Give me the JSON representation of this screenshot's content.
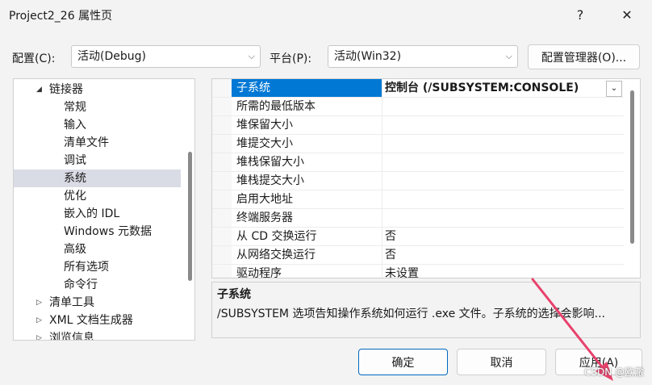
{
  "window": {
    "title": "Project2_26 属性页",
    "help_glyph": "?",
    "close_glyph": "✕"
  },
  "config": {
    "config_label": "配置(C):",
    "config_value": "活动(Debug)",
    "platform_label": "平台(P):",
    "platform_value": "活动(Win32)",
    "manager_button": "配置管理器(O)..."
  },
  "tree": {
    "items": [
      {
        "label": "链接器",
        "expander": "◢"
      },
      {
        "label": "常规"
      },
      {
        "label": "输入"
      },
      {
        "label": "清单文件"
      },
      {
        "label": "调试"
      },
      {
        "label": "系统"
      },
      {
        "label": "优化"
      },
      {
        "label": "嵌入的 IDL"
      },
      {
        "label": "Windows 元数据"
      },
      {
        "label": "高级"
      },
      {
        "label": "所有选项"
      },
      {
        "label": "命令行"
      },
      {
        "label": "清单工具",
        "expander": "▷"
      },
      {
        "label": "XML 文档生成器",
        "expander": "▷"
      },
      {
        "label": "浏览信息",
        "expander": "▷"
      }
    ]
  },
  "grid": {
    "dropdown_glyph": "⌄",
    "rows": [
      {
        "key": "子系统",
        "value": "控制台 (/SUBSYSTEM:CONSOLE)"
      },
      {
        "key": "所需的最低版本",
        "value": ""
      },
      {
        "key": "堆保留大小",
        "value": ""
      },
      {
        "key": "堆提交大小",
        "value": ""
      },
      {
        "key": "堆栈保留大小",
        "value": ""
      },
      {
        "key": "堆栈提交大小",
        "value": ""
      },
      {
        "key": "启用大地址",
        "value": ""
      },
      {
        "key": "终端服务器",
        "value": ""
      },
      {
        "key": "从 CD 交换运行",
        "value": "否"
      },
      {
        "key": "从网络交换运行",
        "value": "否"
      },
      {
        "key": "驱动程序",
        "value": "未设置"
      }
    ]
  },
  "description": {
    "title": "子系统",
    "text": "/SUBSYSTEM 选项告知操作系统如何运行 .exe 文件。子系统的选择会影响..."
  },
  "buttons": {
    "ok": "确定",
    "cancel": "取消",
    "apply": "应用(A)"
  },
  "watermark": "CSDN @欧澈"
}
